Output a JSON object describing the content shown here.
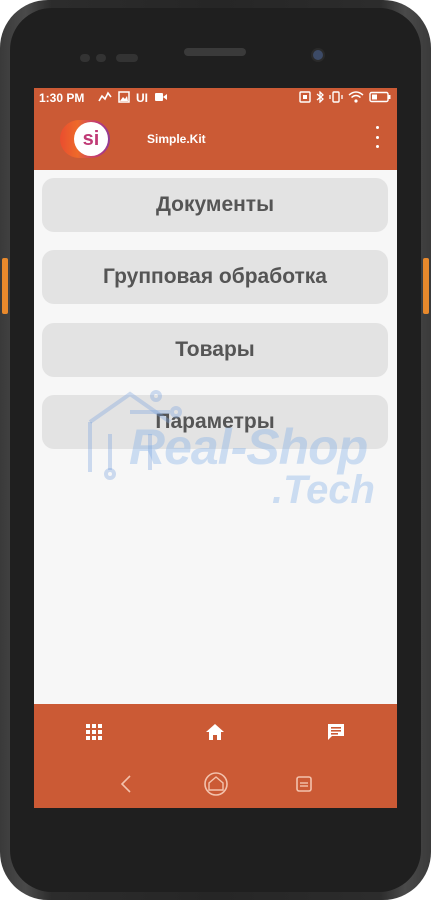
{
  "status_bar": {
    "time": "1:30 PM",
    "ui_label": "UI",
    "left_icons": [
      "chart-icon",
      "image-icon",
      "video-icon"
    ],
    "right_icons": [
      "nfc-icon",
      "bluetooth-icon",
      "vibrate-icon",
      "wifi-icon",
      "battery-icon"
    ]
  },
  "app_bar": {
    "logo_text": "si",
    "title": "Simple.Kit",
    "menu_icon": "more-vertical-icon"
  },
  "menu": {
    "items": [
      {
        "label": "Документы"
      },
      {
        "label": "Групповая обработка"
      },
      {
        "label": "Товары"
      },
      {
        "label": "Параметры"
      }
    ]
  },
  "watermark": {
    "line1": "Real-Shop",
    "line2": ".Tech"
  },
  "bottom_nav": {
    "items": [
      "grid-icon",
      "home-icon",
      "chat-icon"
    ]
  },
  "system_nav": {
    "items": [
      "back-icon",
      "home-circle-icon",
      "recents-icon"
    ]
  },
  "colors": {
    "accent": "#cb5a35",
    "button_bg": "#e3e3e3",
    "button_text": "#555555",
    "side_button": "#e8892c"
  }
}
